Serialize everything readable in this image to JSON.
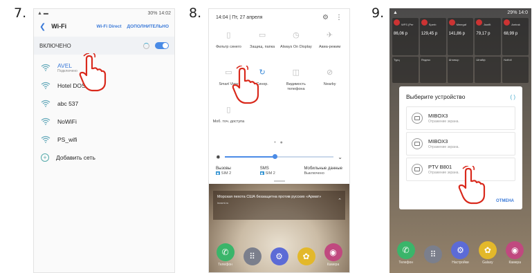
{
  "steps": [
    "7.",
    "8.",
    "9."
  ],
  "colors": {
    "accent": "#4a8be6",
    "link": "#3b7ad8",
    "hand": "#d9291c"
  },
  "panel1": {
    "title": "Wi-Fi",
    "wifi_direct": "Wi-Fi Direct",
    "more": "ДОПОЛНИТЕЛЬНО",
    "enabled_label": "ВКЛЮЧЕНО",
    "status_right": "30% 14:02",
    "networks": [
      {
        "name": "AVEL",
        "sub": "Подключено",
        "highlight": true
      },
      {
        "name": "Hotel DOSAAF",
        "sub": ""
      },
      {
        "name": "abc 537",
        "sub": ""
      },
      {
        "name": "NoWiFi",
        "sub": ""
      },
      {
        "name": "PS_wifi",
        "sub": ""
      }
    ],
    "add_network": "Добавить сеть"
  },
  "panel2": {
    "datetime": "14:04 | Пт, 27 апреля",
    "tiles": [
      {
        "label": "Фильтр синего",
        "icon": "filter-icon"
      },
      {
        "label": "Защищ. папка",
        "icon": "folder-icon"
      },
      {
        "label": "Always On Display",
        "icon": "clock-icon"
      },
      {
        "label": "Авиа-режим",
        "icon": "airplane-icon"
      },
      {
        "label": "Smart View",
        "icon": "smart-view-icon"
      },
      {
        "label": "Синхр.",
        "icon": "sync-icon"
      },
      {
        "label": "Видимость телефона",
        "icon": "visibility-icon"
      },
      {
        "label": "Nearby",
        "icon": "nearby-icon"
      },
      {
        "label": "Моб. точ. доступа",
        "icon": "hotspot-icon"
      }
    ],
    "brightness": 0.46,
    "sim_cols": [
      {
        "title": "Вызовы",
        "value": "SIM 2"
      },
      {
        "title": "SMS",
        "value": "SIM 2"
      },
      {
        "title": "Мобильные данные",
        "value": "Выключено"
      }
    ],
    "news": {
      "headline": "Морская пехота США беззащитна против русских «Армат»",
      "meta": "inosmi.ru"
    },
    "dock": [
      "Телефон",
      "",
      "",
      "",
      "Камера"
    ]
  },
  "panel3": {
    "status_right": "29% 14:0",
    "widgets_top": [
      {
        "label": "WFS (Per",
        "value": "86,06 р"
      },
      {
        "label": "Sperb",
        "value": "129,45 р"
      },
      {
        "label": "Mmegaf",
        "value": "141,86 р"
      },
      {
        "label": "Asnfit",
        "value": "79,17 р"
      },
      {
        "label": "Amtrak",
        "value": "68,99 р"
      }
    ],
    "widgets_bottom": [
      {
        "label": "Турц"
      },
      {
        "label": "Яндекс"
      },
      {
        "label": "Штовыр"
      },
      {
        "label": "Штайф"
      },
      {
        "label": "Notfoll"
      }
    ],
    "dialog": {
      "title": "Выберите устройство",
      "devices": [
        {
          "name": "MIBOX3",
          "sub": "Отражение экрана."
        },
        {
          "name": "MIBOX3",
          "sub": "Отражение экрана."
        },
        {
          "name": "PTV B801",
          "sub": "Отражение экрана."
        }
      ],
      "cancel": "ОТМЕНА"
    },
    "dock": [
      "Телефон",
      "",
      "Настройки",
      "Galaxy",
      "Камера"
    ]
  }
}
